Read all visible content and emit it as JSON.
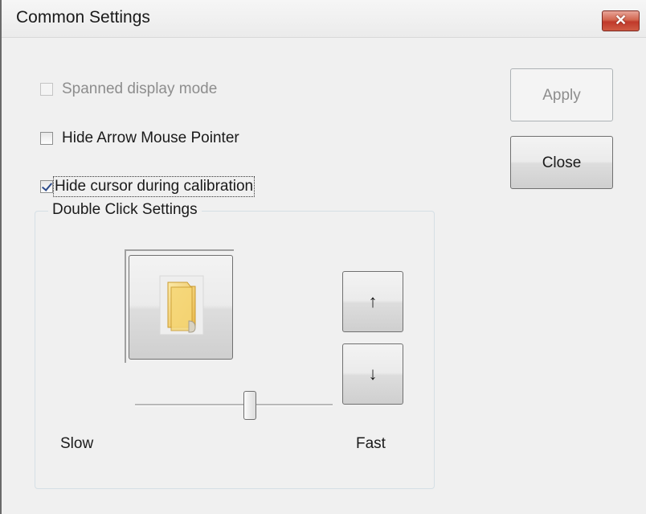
{
  "window": {
    "title": "Common Settings",
    "close_glyph": "✕"
  },
  "options": {
    "spanned_label": "Spanned display mode",
    "spanned_checked": false,
    "spanned_enabled": false,
    "hide_arrow_label": "Hide Arrow Mouse Pointer",
    "hide_arrow_checked": false,
    "hide_cursor_label": "Hide cursor during calibration",
    "hide_cursor_checked": true
  },
  "buttons": {
    "apply_label": "Apply",
    "apply_enabled": false,
    "close_label": "Close"
  },
  "double_click": {
    "group_label": "Double Click Settings",
    "up_glyph": "↑",
    "down_glyph": "↓",
    "slow_label": "Slow",
    "fast_label": "Fast",
    "speed_fraction": 0.58
  },
  "colors": {
    "close_button": "#c0392b",
    "folder": "#f1cf6a",
    "checkmark": "#2b4a8a"
  }
}
